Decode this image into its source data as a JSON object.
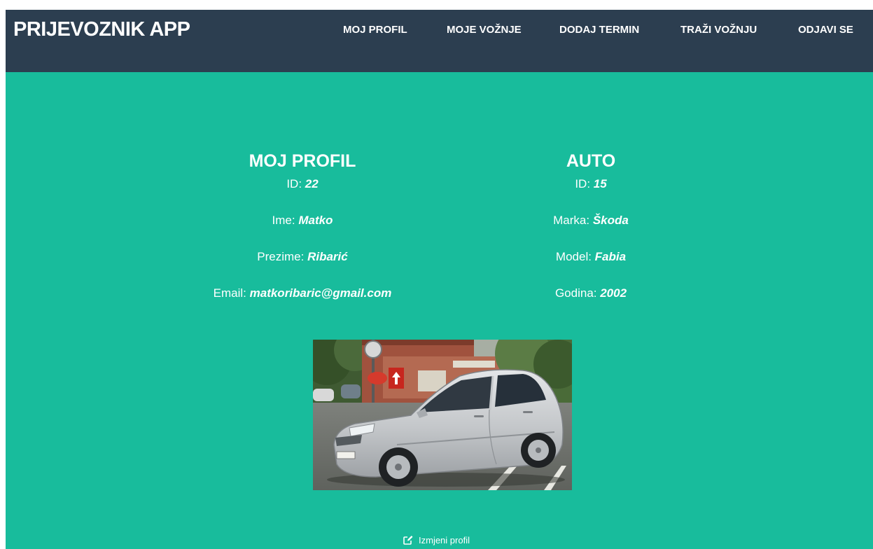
{
  "navbar": {
    "brand": "PRIJEVOZNIK APP",
    "items": [
      "MOJ PROFIL",
      "MOJE VOŽNJE",
      "DODAJ TERMIN",
      "TRAŽI VOŽNJU",
      "ODJAVI SE"
    ]
  },
  "profile": {
    "title": "MOJ PROFIL",
    "id_label": "ID: ",
    "id_value": "22",
    "ime_label": "Ime: ",
    "ime_value": "Matko",
    "prezime_label": "Prezime: ",
    "prezime_value": "Ribarić",
    "email_label": "Email: ",
    "email_value": "matkoribaric@gmail.com"
  },
  "car": {
    "title": "AUTO",
    "id_label": "ID: ",
    "id_value": "15",
    "marka_label": "Marka: ",
    "marka_value": "Škoda",
    "model_label": "Model: ",
    "model_value": "Fabia",
    "godina_label": "Godina: ",
    "godina_value": "2002",
    "photo_icon": "car-photo"
  },
  "actions": {
    "edit_label": "Izmjeni profil",
    "edit_icon": "edit-icon"
  },
  "colors": {
    "navbar": "#2c3e50",
    "background": "#18bc9c",
    "text": "#ffffff"
  }
}
